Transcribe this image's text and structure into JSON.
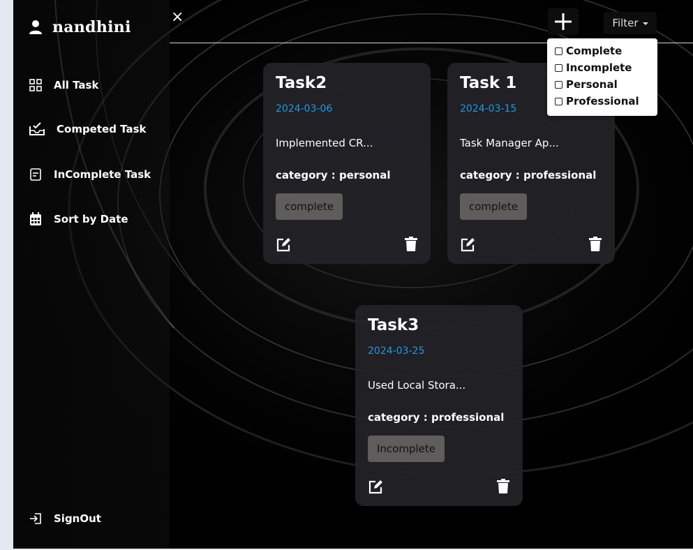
{
  "sidebar": {
    "user_name": "nandhini",
    "items": [
      {
        "label": "All Task",
        "icon": "grid-icon"
      },
      {
        "label": "Competed Task",
        "icon": "inbox-check-icon"
      },
      {
        "label": "InComplete Task",
        "icon": "note-icon"
      },
      {
        "label": "Sort by Date",
        "icon": "calendar-icon"
      }
    ],
    "signout_label": "SignOut"
  },
  "header": {
    "close_label": "×",
    "add_label": "+",
    "filter_label": "Filter"
  },
  "filter_options": [
    "Complete",
    "Incomplete",
    "Personal",
    "Professional"
  ],
  "tasks": [
    {
      "title": "Task2",
      "date": "2024-03-06",
      "description": "Implemented CR...",
      "category": "category : personal",
      "status": "complete"
    },
    {
      "title": "Task 1",
      "date": "2024-03-15",
      "description": "Task Manager Ap...",
      "category": "category : professional",
      "status": "complete"
    },
    {
      "title": "Task3",
      "date": "2024-03-25",
      "description": "Used Local Stora...",
      "category": "category : professional",
      "status": "Incomplete"
    }
  ],
  "colors": {
    "date": "#1e9be8",
    "status_bg": "#5f5d5b",
    "card_bg": "#222228"
  }
}
